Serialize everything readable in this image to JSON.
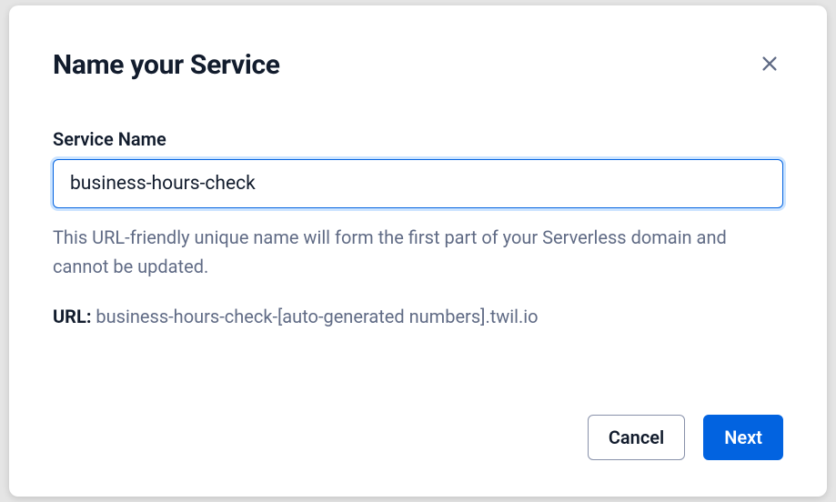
{
  "modal": {
    "title": "Name your Service",
    "fieldLabel": "Service Name",
    "serviceName": "business-hours-check",
    "helpText": "This URL-friendly unique name will form the first part of your Serverless domain and cannot be updated.",
    "urlLabel": "URL:",
    "urlPreview": "business-hours-check-[auto-generated numbers].twil.io",
    "cancelLabel": "Cancel",
    "nextLabel": "Next"
  }
}
